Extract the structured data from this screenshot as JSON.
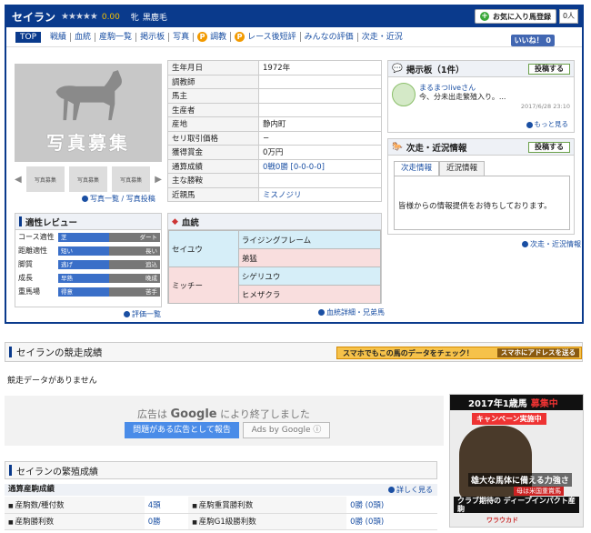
{
  "header": {
    "name": "セイラン",
    "stars": "★★★★★",
    "rating": "0.00",
    "sex": "牝",
    "coat": "黒鹿毛",
    "fav_label": "お気に入り馬登録",
    "fav_count": "0人"
  },
  "nav": {
    "top": "TOP",
    "items": [
      "戦績",
      "血統",
      "産駒一覧",
      "掲示板",
      "写真",
      "調教",
      "レース後短評",
      "みんなの評価",
      "次走・近況"
    ],
    "like": "いいね！ 0"
  },
  "photo": {
    "placeholder": "写真募集",
    "thumb_label": "写真募集",
    "links": "写真一覧 / 写真投稿"
  },
  "info": {
    "rows": [
      {
        "k": "生年月日",
        "v": "1972年"
      },
      {
        "k": "調教師",
        "v": ""
      },
      {
        "k": "馬主",
        "v": ""
      },
      {
        "k": "生産者",
        "v": ""
      },
      {
        "k": "産地",
        "v": "静内町"
      },
      {
        "k": "セリ取引価格",
        "v": "−"
      },
      {
        "k": "獲得賞金",
        "v": "0万円"
      },
      {
        "k": "通算成績",
        "v": "0戦0勝 [0-0-0-0]"
      },
      {
        "k": "主な勝鞍",
        "v": ""
      },
      {
        "k": "近親馬",
        "v": "ミスノジリ"
      }
    ]
  },
  "review": {
    "title": "適性レビュー",
    "rows": [
      {
        "label": "コース適性",
        "left": "芝",
        "right": "ダート"
      },
      {
        "label": "距離適性",
        "left": "短い",
        "right": "長い"
      },
      {
        "label": "脚質",
        "left": "逃げ",
        "right": "追込"
      },
      {
        "label": "成長",
        "left": "早熟",
        "right": "晩成"
      },
      {
        "label": "重馬場",
        "left": "得意",
        "right": "苦手"
      }
    ],
    "link": "評価一覧"
  },
  "blood": {
    "title": "血統",
    "sire": "セイユウ",
    "dam": "ミッチー",
    "ss": "ライジングフレーム",
    "sd": "弟猛",
    "ds": "シゲリユウ",
    "dd": "ヒメザクラ",
    "link": "血統詳細・兄弟馬"
  },
  "board": {
    "title": "掲示板（1件）",
    "post": "投稿する",
    "poster": "まるまつliveさん",
    "message": "今、分未出走繁殖入り。...",
    "date": "2017/6/28 23:10",
    "more": "もっと見る"
  },
  "race": {
    "title": "次走・近況情報",
    "post": "投稿する",
    "tab1": "次走情報",
    "tab2": "近況情報",
    "message": "皆様からの情報提供をお待ちしております。",
    "link": "次走・近況情報"
  },
  "results": {
    "title": "セイランの競走成績",
    "banner": "スマホでもこの馬のデータをチェック！",
    "banner_btn": "スマホにアドレスを送る",
    "none": "競走データがありません"
  },
  "ad": {
    "text_pre": "広告は",
    "text_google": "Google",
    "text_post": "により終了しました",
    "report": "問題がある広告として報告",
    "by": "Ads by Google"
  },
  "promo": {
    "title": "2017年1歳馬",
    "title_red": "募集中",
    "campaign": "キャンペーン実施中",
    "copy": "雄大な馬体に備える力強さ",
    "copy2": "母は米国重賞馬",
    "main": "クラブ期待の ディープインパクト産駒",
    "brand": "ワラウカド"
  },
  "breeding": {
    "title": "セイランの繁殖成績",
    "subtitle": "通算産駒成績",
    "more": "詳しく見る",
    "rows": [
      {
        "k1": "産駒数/種付数",
        "v1": "4頭",
        "k2": "産駒重賞勝利数",
        "v2": "0勝 (0頭)"
      },
      {
        "k1": "産駒勝利数",
        "v1": "0勝",
        "k2": "産駒G1級勝利数",
        "v2": "0勝 (0頭)"
      }
    ]
  }
}
